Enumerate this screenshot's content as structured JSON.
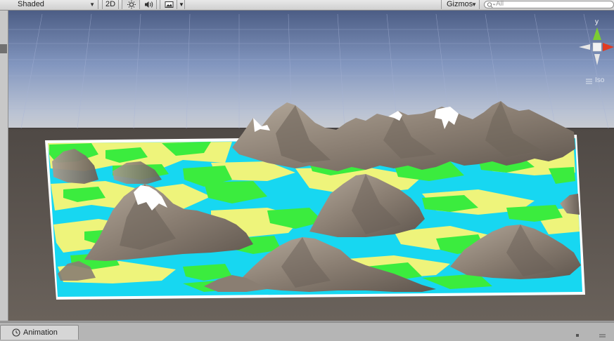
{
  "toolbar": {
    "draw_mode": "Shaded",
    "mode_2d": "2D",
    "lighting_icon": "sun-icon",
    "audio_icon": "speaker-icon",
    "effects_icon": "image-icon",
    "gizmos_label": "Gizmos",
    "search_placeholder": "All"
  },
  "scene_gizmo": {
    "axis_label": "y",
    "projection_label": "Iso",
    "colors": {
      "x_axis": "#e23b22",
      "y_axis": "#7ccc32",
      "z_axis": "#5677d3"
    }
  },
  "bottom": {
    "tab_label": "Animation",
    "tab_icon": "clock-icon"
  },
  "colors": {
    "sky": "#8fa8d0",
    "ground": "#5e5751",
    "water": "#17d7f1",
    "sand": "#eef47b",
    "grass": "#3bec3e",
    "rock": "#8c7f73",
    "snow": "#ffffff"
  }
}
